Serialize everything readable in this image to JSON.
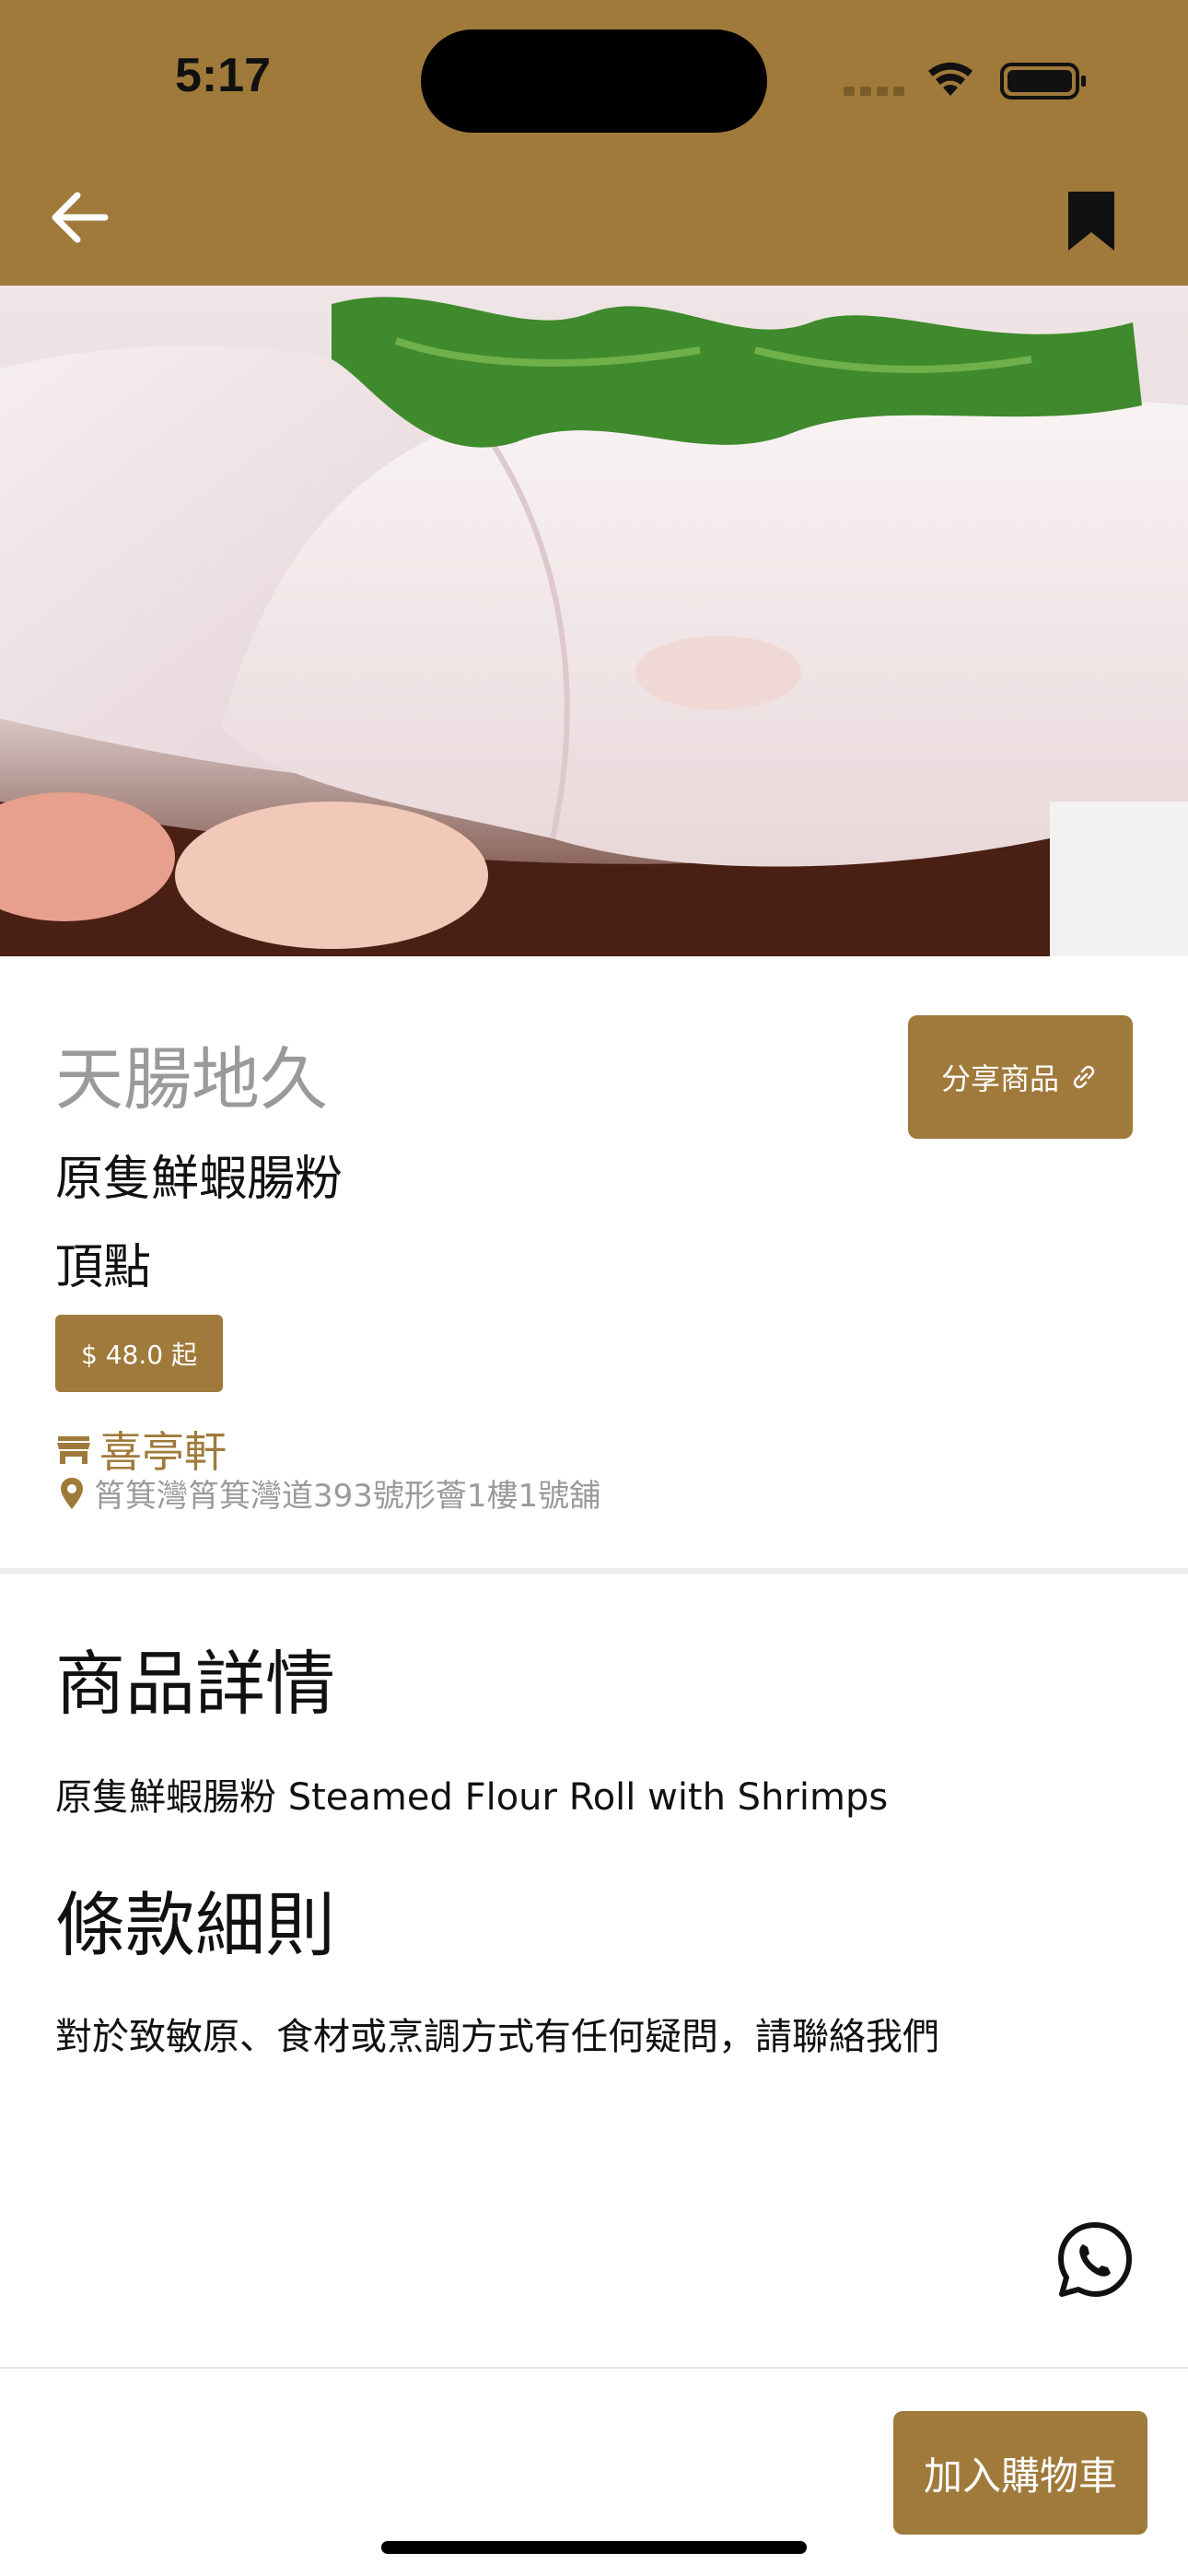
{
  "status_bar": {
    "time": "5:17"
  },
  "colors": {
    "brand": "#a07a3b",
    "muted": "#9a9a9a",
    "text": "#111111"
  },
  "nav": {
    "back_icon": "arrow-left-icon",
    "bookmark_icon": "bookmark-icon"
  },
  "carousel": {
    "image": "steamed-shrimp-rice-roll-photo",
    "pages": 1,
    "active_page": 1
  },
  "product": {
    "brand": "天腸地久",
    "name": "原隻鮮蝦腸粉",
    "category": "頂點",
    "price": "$ 48.0 起",
    "share_label": "分享商品",
    "shop_name": "喜亭軒",
    "address": "筲箕灣筲箕灣道393號形薈1樓1號舖"
  },
  "details": {
    "heading": "商品詳情",
    "text": "原隻鮮蝦腸粉 Steamed Flour Roll with Shrimps"
  },
  "terms": {
    "heading": "條款細則",
    "text": "對於致敏原、食材或烹調方式有任何疑問，請聯絡我們"
  },
  "footer": {
    "add_to_cart_label": "加入購物車",
    "contact_icon": "whatsapp-icon"
  }
}
